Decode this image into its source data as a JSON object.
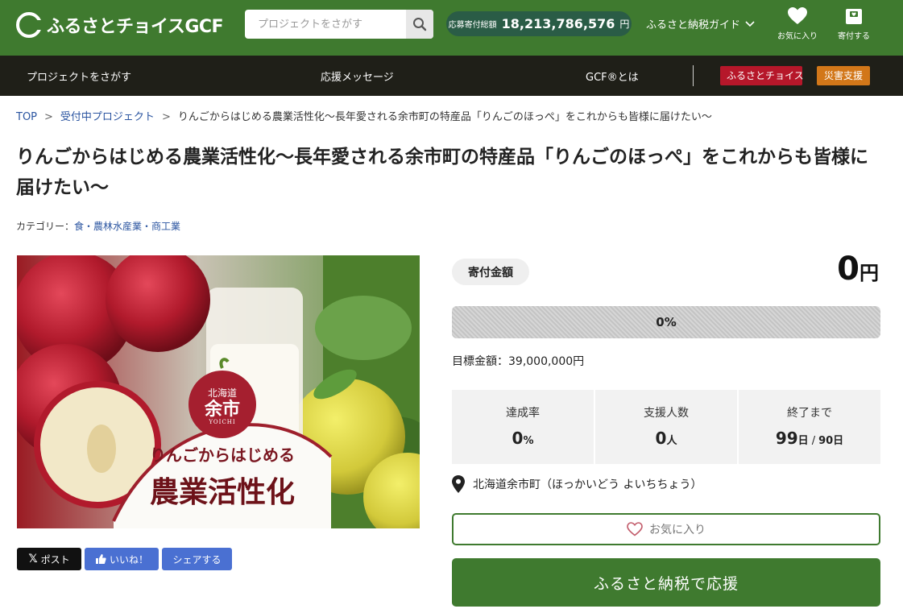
{
  "header": {
    "logo_text": "ふるさとチョイスGCF",
    "search_placeholder": "プロジェクトをさがす",
    "total_label": "応募寄付総額",
    "total_value": "18,213,786,576",
    "total_unit": "円",
    "guide_label": "ふるさと納税ガイド",
    "favorites_label": "お気に入り",
    "donate_label": "寄付する"
  },
  "nav": {
    "find": "プロジェクトをさがす",
    "messages": "応援メッセージ",
    "about": "GCF®とは",
    "furusato": "ふるさとチョイス",
    "disaster": "災害支援"
  },
  "breadcrumb": {
    "top": "TOP",
    "projects": "受付中プロジェクト",
    "current": "りんごからはじめる農業活性化〜長年愛される余市町の特産品「りんごのほっぺ」をこれからも皆様に届けたい〜"
  },
  "project": {
    "title": "りんごからはじめる農業活性化〜長年愛される余市町の特産品「りんごのほっぺ」をこれからも皆様に届けたい〜",
    "category_label": "カテゴリー：",
    "category_value": "食・農林水産業・商工業"
  },
  "hero": {
    "region_top": "北海道",
    "region_name": "余市",
    "region_roman": "YOICHI",
    "headline_small": "りんごからはじめる",
    "headline_big": "農業活性化"
  },
  "share": {
    "post": "ポスト",
    "like": "いいね！",
    "share": "シェアする"
  },
  "funding": {
    "amount_label": "寄付金額",
    "amount_value": "0",
    "amount_unit": "円",
    "progress_percent": 0,
    "progress_text": "0%",
    "goal_text": "目標金額：39,000,000円",
    "rate_label": "達成率",
    "rate_value": "0",
    "rate_unit": "%",
    "supporters_label": "支援人数",
    "supporters_value": "0",
    "supporters_unit": "人",
    "remaining_label": "終了まで",
    "remaining_value": "99",
    "remaining_unit": "日",
    "remaining_total": "90日",
    "location": "北海道余市町（ほっかいどう よいちちょう）",
    "favorite_button": "お気に入り",
    "support_button": "ふるさと納税で応援"
  },
  "colors": {
    "brand_green": "#3f7a2f",
    "nav_dark": "#1f1f18",
    "badge_red": "#b6172a",
    "badge_orange": "#d27719",
    "link_blue": "#2a54a0"
  }
}
